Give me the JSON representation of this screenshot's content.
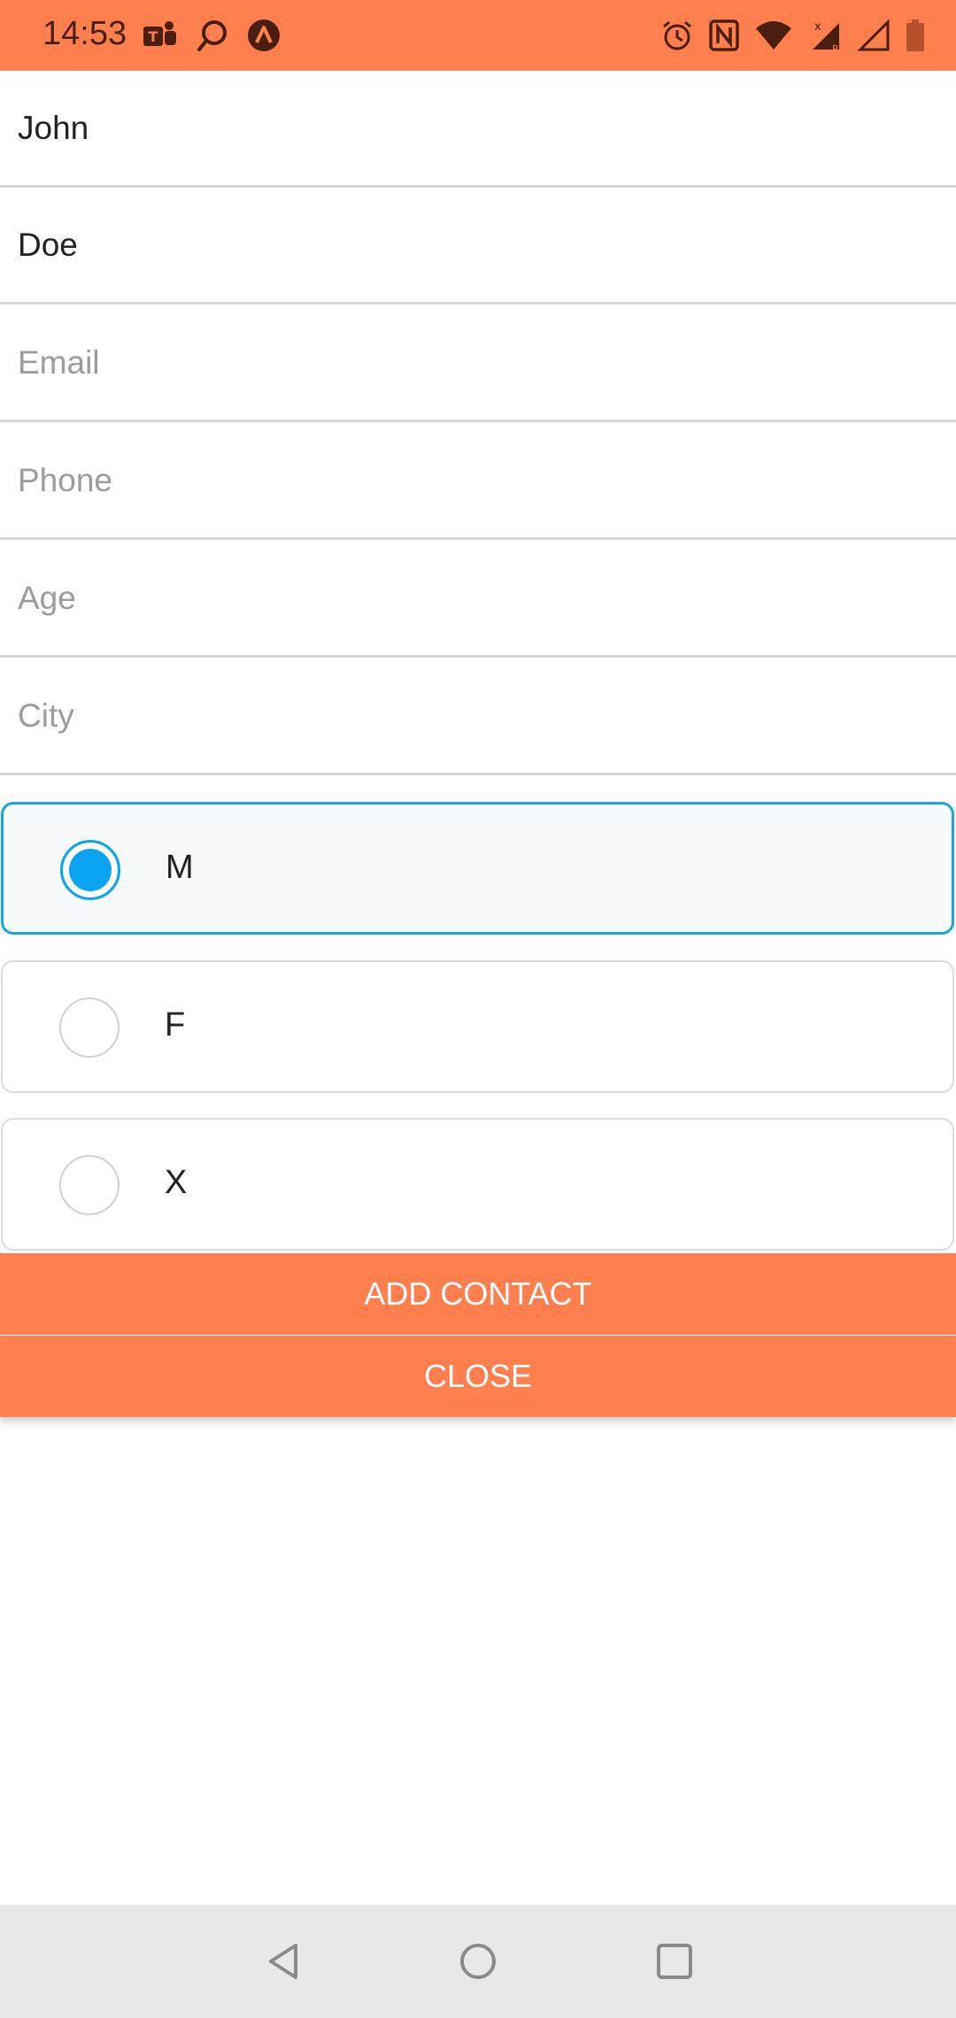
{
  "status_bar": {
    "time": "14:53",
    "left_icons": [
      "teams-icon",
      "chat-icon",
      "arrow-app-icon"
    ],
    "right_icons": [
      "alarm-icon",
      "nfc-icon",
      "wifi-icon",
      "signal-x-icon",
      "signal-icon",
      "battery-icon"
    ],
    "background": "#FF7F4F"
  },
  "form": {
    "first_name": {
      "value": "John",
      "placeholder": ""
    },
    "last_name": {
      "value": "Doe",
      "placeholder": ""
    },
    "email": {
      "value": "",
      "placeholder": "Email"
    },
    "phone": {
      "value": "",
      "placeholder": "Phone"
    },
    "age": {
      "value": "",
      "placeholder": "Age"
    },
    "city": {
      "value": "",
      "placeholder": "City"
    }
  },
  "gender_options": [
    {
      "label": "M",
      "selected": true
    },
    {
      "label": "F",
      "selected": false
    },
    {
      "label": "X",
      "selected": false
    }
  ],
  "buttons": {
    "add_contact": "ADD CONTACT",
    "close": "CLOSE"
  },
  "nav_bar": {
    "icons": [
      "back-icon",
      "home-icon",
      "recents-icon"
    ]
  },
  "colors": {
    "accent": "#FF7F4F",
    "radio_selected": "#0AA5F2",
    "selected_border": "#1AA6D8"
  }
}
